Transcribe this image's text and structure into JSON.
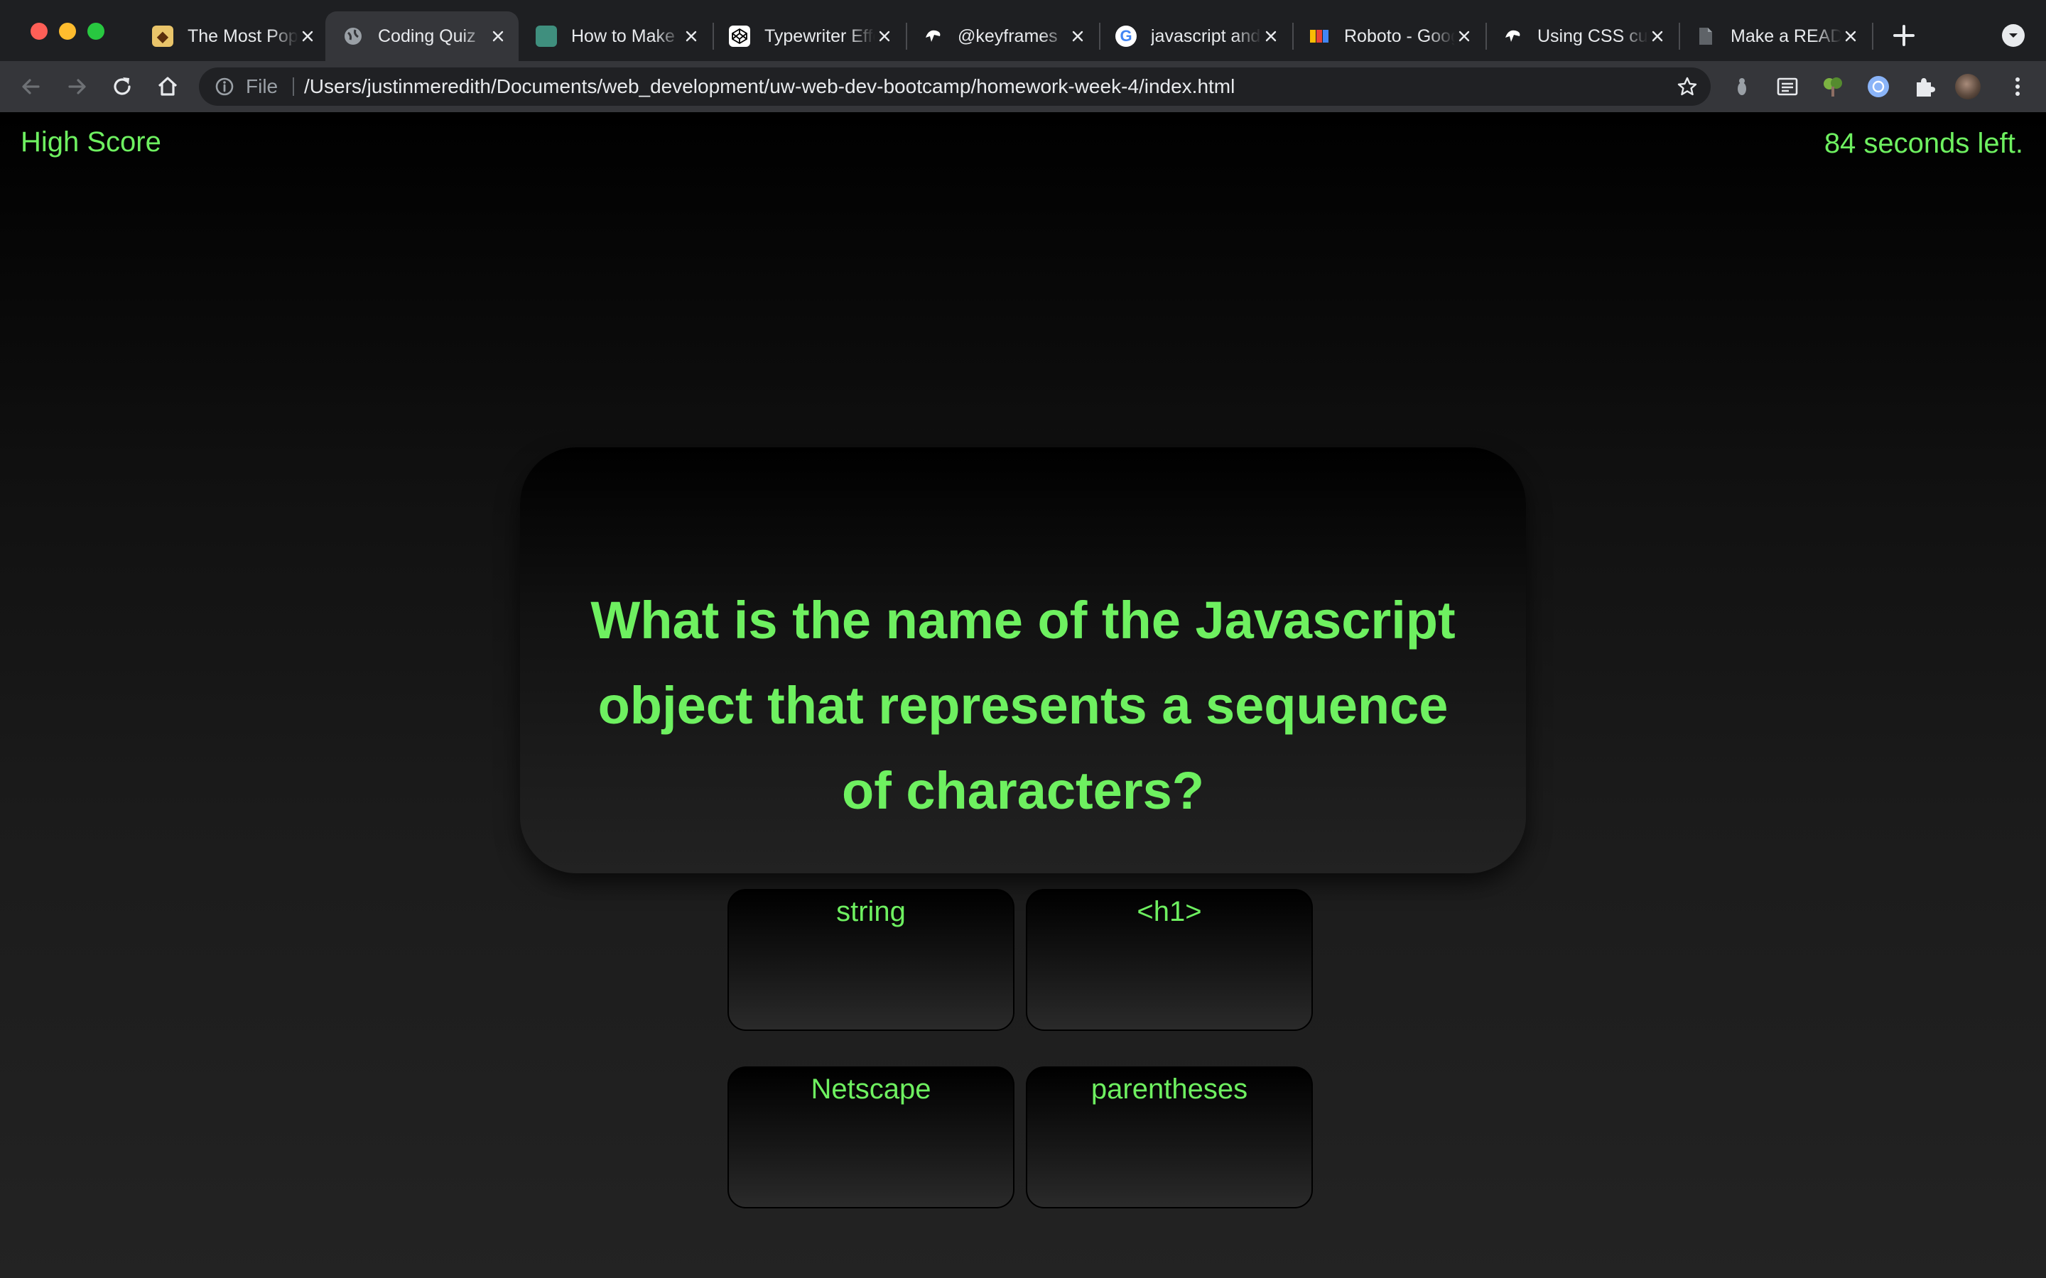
{
  "browser": {
    "tabs": [
      {
        "title": "The Most Popular",
        "icon": "wizard-favicon-icon",
        "active": false
      },
      {
        "title": "Coding Quiz",
        "icon": "globe-favicon-icon",
        "active": true
      },
      {
        "title": "How to Make",
        "icon": "image-favicon-icon",
        "active": false
      },
      {
        "title": "Typewriter Effect",
        "icon": "codepen-favicon-icon",
        "active": false
      },
      {
        "title": "@keyframes",
        "icon": "mdn-favicon-icon",
        "active": false
      },
      {
        "title": "javascript and",
        "icon": "google-favicon-icon",
        "active": false
      },
      {
        "title": "Roboto - Google Fonts",
        "icon": "google-fonts-favicon-icon",
        "active": false
      },
      {
        "title": "Using CSS custom",
        "icon": "mdn-favicon-icon",
        "active": false
      },
      {
        "title": "Make a README",
        "icon": "document-favicon-icon",
        "active": false
      }
    ],
    "address_bar": {
      "scheme_label": "File",
      "url": "/Users/justinmeredith/Documents/web_development/uw-web-dev-bootcamp/homework-week-4/index.html"
    }
  },
  "page": {
    "high_score_link": "High Score",
    "timer_text": "84 seconds left.",
    "question": "What is the name of the Javascript object that represents a sequence of characters?",
    "answers": [
      "string",
      "<h1>",
      "Netscape",
      "parentheses"
    ]
  },
  "colors": {
    "accent_green": "#6ef060",
    "page_background_top": "#000000",
    "page_background_bottom": "#232323",
    "chrome_frame": "#1e1f22",
    "chrome_toolbar": "#35363a"
  }
}
